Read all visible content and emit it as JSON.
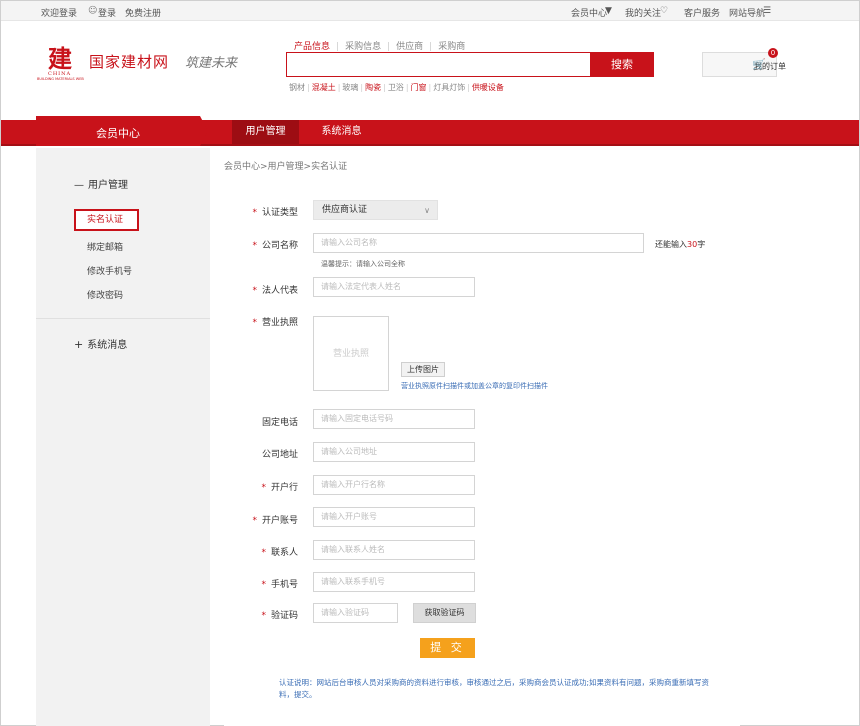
{
  "topbar": {
    "welcome": "欢迎登录",
    "login": "登录",
    "register": "免费注册",
    "member_center": "会员中心",
    "my_favorites": "我的关注",
    "customer_service": "客户服务",
    "site_nav": "网站导航",
    "icons": [
      "user-icon",
      "dropdown-caret-icon",
      "heart-icon",
      "list-icon"
    ]
  },
  "header": {
    "logo_cn": "国家建材网",
    "logo_en": "CHINA",
    "logo_en_sub": "BUILDING MATERIALS WEB",
    "slogan": "筑建未来",
    "search_tabs": [
      "产品信息",
      "采购信息",
      "供应商",
      "采购商"
    ],
    "search_button": "搜索",
    "hot_links": [
      {
        "label": "钢材",
        "red": false
      },
      {
        "label": "混凝土",
        "red": true
      },
      {
        "label": "玻璃",
        "red": false
      },
      {
        "label": "陶瓷",
        "red": true
      },
      {
        "label": "卫浴",
        "red": false
      },
      {
        "label": "门窗",
        "red": true
      },
      {
        "label": "灯具灯饰",
        "red": false
      },
      {
        "label": "供暖设备",
        "red": true
      }
    ],
    "my_orders": "我的订单",
    "cart_count": "0"
  },
  "nav": {
    "member_center": "会员中心",
    "user_management": "用户管理",
    "system_messages": "系统消息"
  },
  "sidebar": {
    "group_user": "用户管理",
    "items": [
      "实名认证",
      "绑定邮箱",
      "修改手机号",
      "修改密码"
    ],
    "group_system": "系统消息",
    "minus": "—",
    "plus": "+"
  },
  "breadcrumb": "会员中心>用户管理>实名认证",
  "form": {
    "cert_type_label": "认证类型",
    "cert_type_value": "供应商认证",
    "company_label": "公司名称",
    "company_placeholder": "请输入公司名称",
    "company_hint": "温馨提示：请输入公司全称",
    "counter_prefix": "还能输入",
    "counter_value": "30",
    "counter_suffix": "字",
    "legal_label": "法人代表",
    "legal_placeholder": "请输入法定代表人姓名",
    "license_label": "营业执照",
    "license_placeholder": "营业执照",
    "upload_button": "上传图片",
    "upload_hint": "营业执照原件扫描件或加盖公章的复印件扫描件",
    "phone_label": "固定电话",
    "phone_placeholder": "请输入固定电话号码",
    "address_label": "公司地址",
    "address_placeholder": "请输入公司地址",
    "bank_label": "开户行",
    "bank_placeholder": "请输入开户行名称",
    "account_label": "开户账号",
    "account_placeholder": "请输入开户账号",
    "contact_label": "联系人",
    "contact_placeholder": "请输入联系人姓名",
    "mobile_label": "手机号",
    "mobile_placeholder": "请输入联系手机号",
    "code_label": "验证码",
    "code_placeholder": "请输入验证码",
    "get_code_button": "获取验证码",
    "submit_button": "提 交",
    "required_mark": "*",
    "note": "认证说明：网站后台审核人员对采购商的资料进行审核，审核通过之后，采购商会员认证成功;如果资料有问题，采购商重新填写资料，提交。"
  },
  "colors": {
    "brand_red": "#c8121a",
    "submit_orange": "#f5a11c",
    "link_blue": "#3a6db5"
  }
}
